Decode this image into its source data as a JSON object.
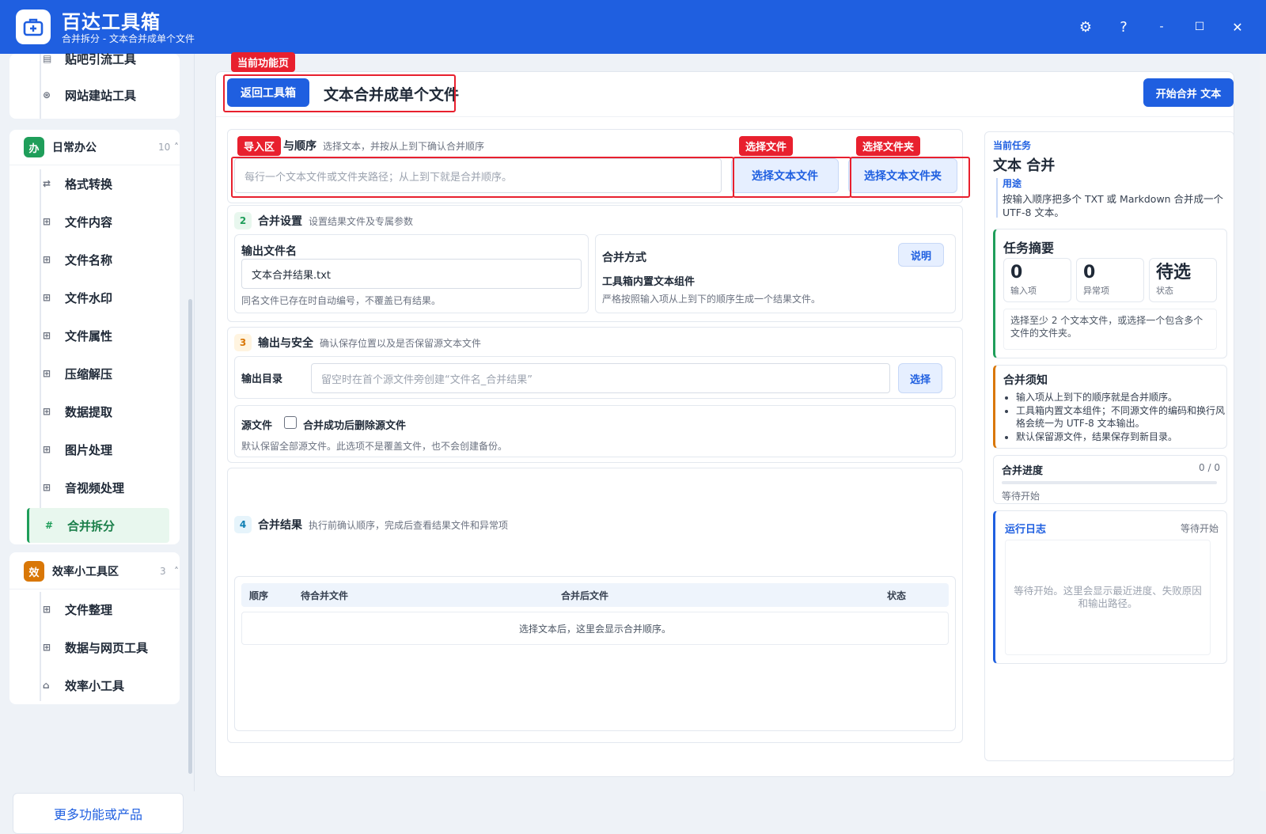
{
  "app": {
    "title": "百达工具箱",
    "subtitle": "合并拆分 - 文本合并成单个文件",
    "colors": {
      "brand": "#1f5fe0",
      "highlight": "#e8202e",
      "active": "#1f9e5a"
    }
  },
  "window_controls": {
    "settings_icon": "⚙",
    "help_icon": "?",
    "minimize_icon": "‑",
    "maximize_icon": "☐",
    "close_icon": "✕"
  },
  "sidebar": {
    "top_items": [
      {
        "label": "贴吧引流工具",
        "icon": "▤"
      },
      {
        "label": "网站建站工具",
        "icon": "⊛"
      }
    ],
    "group_office": {
      "badge": "办",
      "title": "日常办公",
      "count": "10",
      "chevron": "˄",
      "items": [
        {
          "label": "格式转换",
          "icon": "⇄"
        },
        {
          "label": "文件内容",
          "icon": "⊞"
        },
        {
          "label": "文件名称",
          "icon": "⊞"
        },
        {
          "label": "文件水印",
          "icon": "⊞"
        },
        {
          "label": "文件属性",
          "icon": "⊞"
        },
        {
          "label": "压缩解压",
          "icon": "⊞"
        },
        {
          "label": "数据提取",
          "icon": "⊞"
        },
        {
          "label": "图片处理",
          "icon": "⊞"
        },
        {
          "label": "音视频处理",
          "icon": "⊞"
        },
        {
          "label": "合并拆分",
          "icon": "#"
        }
      ]
    },
    "group_efficiency": {
      "badge": "效",
      "title": "效率小工具区",
      "count": "3",
      "chevron": "˄",
      "items": [
        {
          "label": "文件整理",
          "icon": "⊞"
        },
        {
          "label": "数据与网页工具",
          "icon": "⊞"
        },
        {
          "label": "效率小工具",
          "icon": "⌂"
        }
      ]
    },
    "more_button": "更多功能或产品"
  },
  "header": {
    "current_tag": "当前功能页",
    "back_button": "返回工具箱",
    "page_title": "文本合并成单个文件",
    "start_button": "开始合并 文本"
  },
  "section1": {
    "tag": "导入区",
    "title": "导入与顺序",
    "title_visible_tail": "与顺序",
    "desc": "选择文本，并按从上到下确认合并顺序",
    "input_placeholder": "每行一个文本文件或文件夹路径；从上到下就是合并顺序。",
    "select_file_tag": "选择文件",
    "select_folder_tag": "选择文件夹",
    "select_file_button": "选择文本文件",
    "select_folder_button": "选择文本文件夹"
  },
  "section2": {
    "num": "2",
    "title": "合并设置",
    "desc": "设置结果文件及专属参数",
    "output_name_label": "输出文件名",
    "output_name_value": "文本合并结果.txt",
    "output_name_hint": "同名文件已存在时自动编号，不覆盖已有结果。",
    "merge_mode_label": "合并方式",
    "explain_button": "说明",
    "merge_mode_value": "工具箱内置文本组件",
    "merge_mode_hint": "严格按照输入项从上到下的顺序生成一个结果文件。"
  },
  "section3": {
    "num": "3",
    "title": "输出与安全",
    "desc": "确认保存位置以及是否保留源文本文件",
    "dir_label": "输出目录",
    "dir_placeholder": "留空时在首个源文件旁创建“文件名_合并结果”",
    "choose_button": "选择",
    "source_label": "源文件",
    "delete_checkbox_label": "合并成功后删除源文件",
    "source_hint": "默认保留全部源文件。此选项不是覆盖文件，也不会创建备份。"
  },
  "section4": {
    "num": "4",
    "title": "合并结果",
    "desc": "执行前确认顺序，完成后查看结果文件和异常项",
    "columns": [
      "顺序",
      "待合并文件",
      "合并后文件",
      "状态"
    ],
    "empty_text": "选择文本后，这里会显示合并顺序。"
  },
  "right": {
    "task_tag": "当前任务",
    "task_title": "文本 合并",
    "purpose_label": "用途",
    "purpose_text": "按输入顺序把多个 TXT 或 Markdown 合并成一个 UTF-8 文本。",
    "summary_title": "任务摘要",
    "stats": [
      {
        "value": "0",
        "key": "输入项"
      },
      {
        "value": "0",
        "key": "异常项"
      },
      {
        "value": "待选",
        "key": "状态"
      }
    ],
    "summary_hint": "选择至少 2 个文本文件，或选择一个包含多个文件的文件夹。",
    "notes_title": "合并须知",
    "notes": [
      "输入项从上到下的顺序就是合并顺序。",
      "工具箱内置文本组件；不同源文件的编码和换行风格会统一为 UTF-8 文本输出。",
      "默认保留源文件，结果保存到新目录。"
    ],
    "progress_title": "合并进度",
    "progress_count": "0 / 0",
    "progress_value": 0,
    "progress_status": "等待开始",
    "log_title": "运行日志",
    "log_status": "等待开始",
    "log_empty": "等待开始。这里会显示最近进度、失败原因和输出路径。"
  }
}
